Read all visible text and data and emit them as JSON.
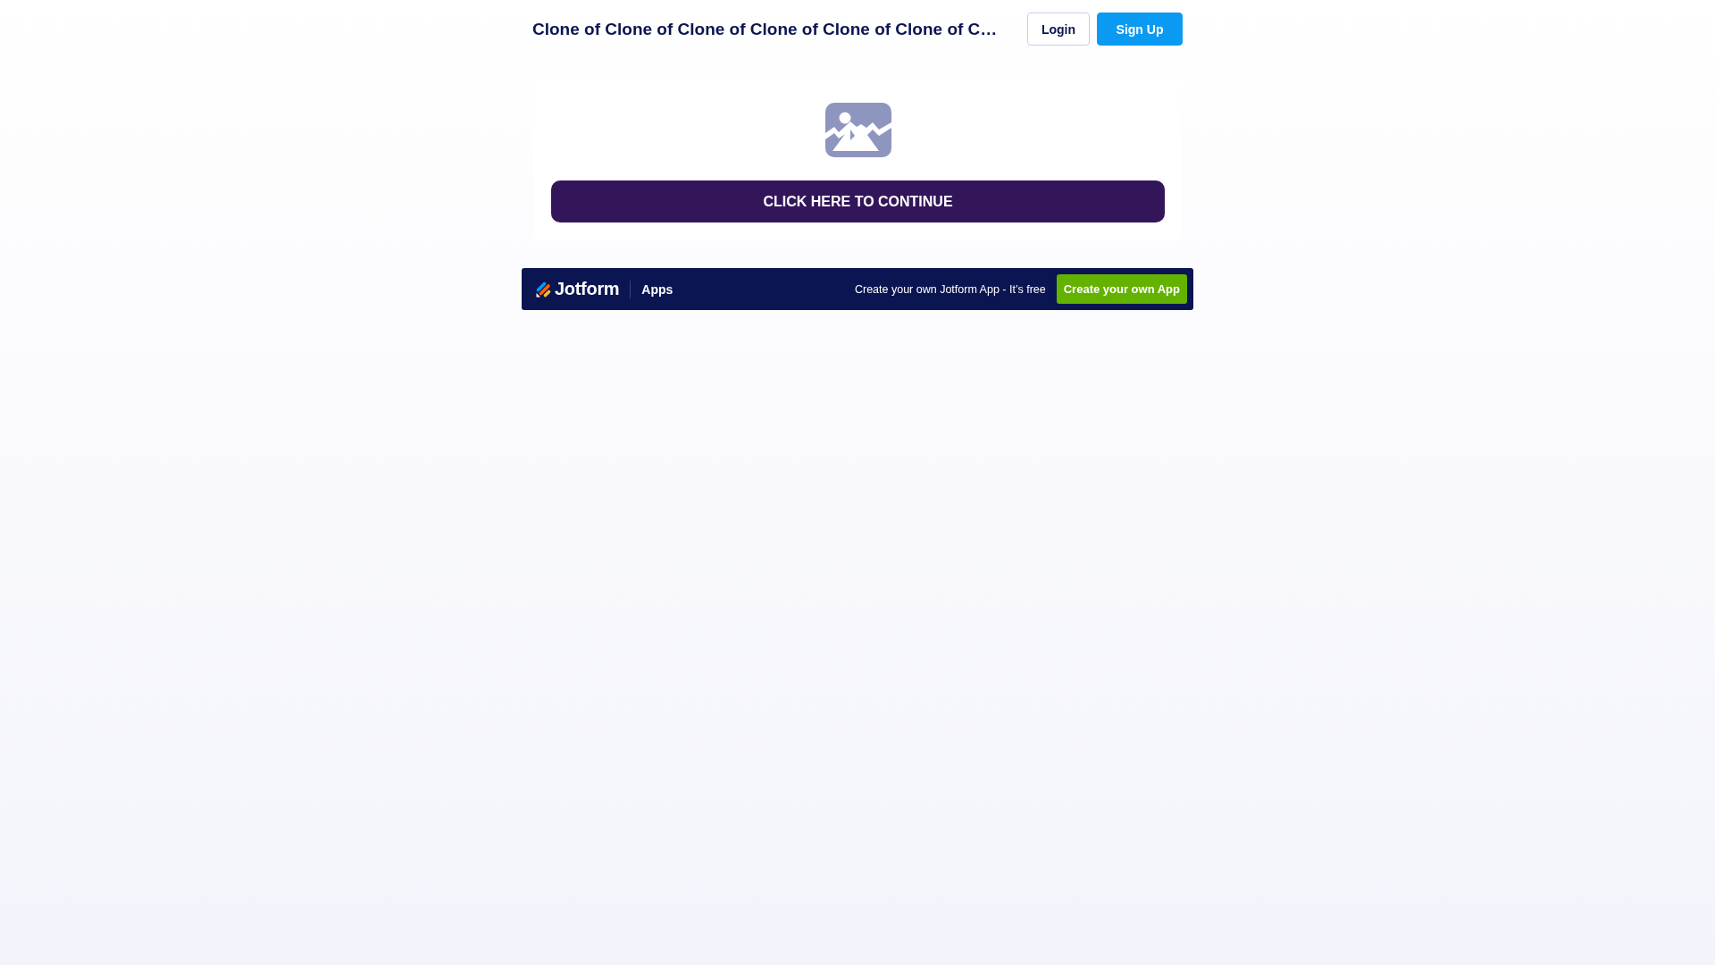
{
  "header": {
    "title": "Clone of Clone of Clone of Clone of Clone of Clone of C…",
    "buttons": [
      {
        "label": "Login",
        "kind": "outline"
      },
      {
        "label": "Sign Up",
        "kind": "primary"
      }
    ]
  },
  "card": {
    "button": {
      "label": "CLICK HERE TO CONTINUE"
    }
  },
  "footer_banner": {
    "brand": "Jotform",
    "section": "Apps",
    "tagline": "Create your own Jotform App - It’s free",
    "button": {
      "label": "Create your own App"
    }
  }
}
